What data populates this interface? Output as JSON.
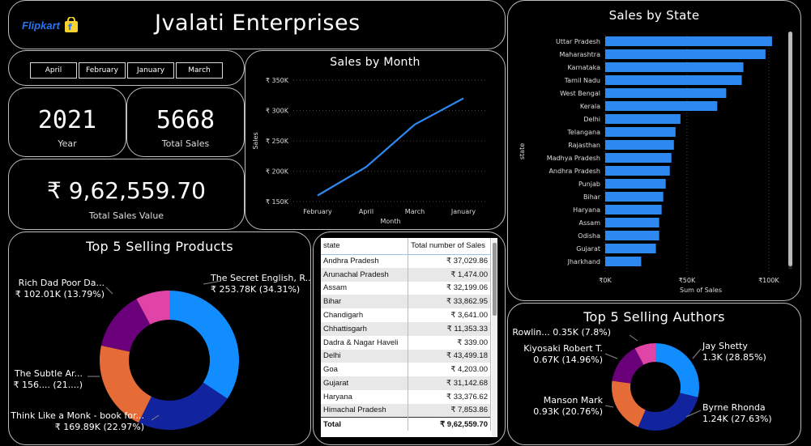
{
  "header": {
    "brand": "Flipkart",
    "title": "Jvalati Enterprises"
  },
  "slicer": {
    "months": [
      "April",
      "February",
      "January",
      "March"
    ]
  },
  "kpis": [
    {
      "value": "2021",
      "label": "Year"
    },
    {
      "value": "5668",
      "label": "Total Sales"
    },
    {
      "value": "₹ 9,62,559.70",
      "label": "Total Sales Value"
    }
  ],
  "colors": {
    "accent": "#2d88ef",
    "blue": "#118dff",
    "navy": "#12239e",
    "orange": "#e66c37",
    "purple": "#6b007b",
    "pink": "#e044a7"
  },
  "sales_by_month": {
    "title": "Sales by Month",
    "type": "line",
    "x": [
      "February",
      "April",
      "March",
      "January"
    ],
    "y": [
      160000,
      207000,
      277000,
      320000
    ],
    "xlabel": "Month",
    "ylabel": "Sales",
    "yticks": [
      "₹ 350K",
      "₹ 300K",
      "₹ 250K",
      "₹ 200K",
      "₹ 150K"
    ],
    "ylim": [
      150000,
      350000
    ]
  },
  "sales_by_state": {
    "title": "Sales by State",
    "type": "bar",
    "categories": [
      "Uttar Pradesh",
      "Maharashtra",
      "Karnataka",
      "Tamil Nadu",
      "West Bengal",
      "Kerala",
      "Delhi",
      "Telangana",
      "Rajasthan",
      "Madhya Pradesh",
      "Andhra Pradesh",
      "Punjab",
      "Bihar",
      "Haryana",
      "Assam",
      "Odisha",
      "Gujarat",
      "Jharkhand"
    ],
    "values": [
      102000,
      98000,
      84500,
      83500,
      74000,
      68500,
      46000,
      43000,
      42000,
      40500,
      39500,
      37000,
      35500,
      34500,
      33000,
      33000,
      31000,
      22000
    ],
    "xlabel": "Sum of Sales",
    "ylabel": "state",
    "xticks": [
      "₹0K",
      "₹50K",
      "₹100K"
    ],
    "xlim": [
      0,
      107000
    ]
  },
  "top_products": {
    "title": "Top 5 Selling Products",
    "type": "pie",
    "slices": [
      {
        "label": "The Secret English, R...",
        "detail": "₹ 253.78K (34.31%)",
        "value": 34.31,
        "color": "#118dff"
      },
      {
        "label": "Think Like a Monk - book for...",
        "detail": "₹ 169.89K (22.97%)",
        "value": 22.97,
        "color": "#12239e"
      },
      {
        "label": "The Subtle Ar...",
        "detail": "₹ 156.... (21....)",
        "value": 21.1,
        "color": "#e66c37"
      },
      {
        "label": "Rich Dad Poor Da...",
        "detail": "₹ 102.01K (13.79%)",
        "value": 13.79,
        "color": "#6b007b"
      },
      {
        "label": "",
        "detail": "",
        "value": 7.83,
        "color": "#e044a7"
      }
    ]
  },
  "top_authors": {
    "title": "Top 5 Selling Authors",
    "type": "pie",
    "slices": [
      {
        "label": "Jay Shetty",
        "detail": "1.3K (28.85%)",
        "value": 28.85,
        "color": "#118dff"
      },
      {
        "label": "Byrne Rhonda",
        "detail": "1.24K (27.63%)",
        "value": 27.63,
        "color": "#12239e"
      },
      {
        "label": "Manson Mark",
        "detail": "0.93K (20.76%)",
        "value": 20.76,
        "color": "#e66c37"
      },
      {
        "label": "Kiyosaki Robert T.",
        "detail": "0.67K (14.96%)",
        "value": 14.96,
        "color": "#6b007b"
      },
      {
        "label": "Rowlin...",
        "detail": "0.35K (7.8%)",
        "value": 7.8,
        "color": "#e044a7"
      }
    ]
  },
  "state_table": {
    "headers": [
      "state",
      "Total number of Sales"
    ],
    "rows": [
      [
        "Andhra Pradesh",
        "₹ 37,029.86"
      ],
      [
        "Arunachal Pradesh",
        "₹ 1,474.00"
      ],
      [
        "Assam",
        "₹ 32,199.06"
      ],
      [
        "Bihar",
        "₹ 33,862.95"
      ],
      [
        "Chandigarh",
        "₹ 3,641.00"
      ],
      [
        "Chhattisgarh",
        "₹ 11,353.33"
      ],
      [
        "Dadra & Nagar Haveli",
        "₹ 339.00"
      ],
      [
        "Delhi",
        "₹ 43,499.18"
      ],
      [
        "Goa",
        "₹ 4,203.00"
      ],
      [
        "Gujarat",
        "₹ 31,142.68"
      ],
      [
        "Haryana",
        "₹ 33,376.62"
      ],
      [
        "Himachal Pradesh",
        "₹ 7,853.86"
      ]
    ],
    "total": [
      "Total",
      "₹ 9,62,559.70"
    ]
  }
}
